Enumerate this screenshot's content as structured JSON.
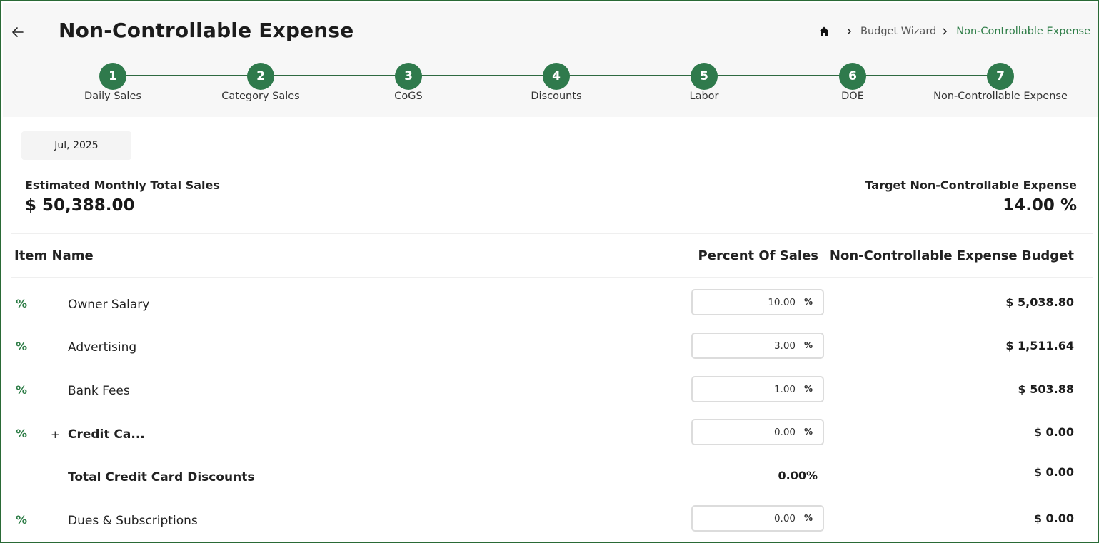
{
  "header": {
    "title": "Non-Controllable Expense",
    "breadcrumb": [
      "Budget Wizard",
      "Non-Controllable Expense"
    ]
  },
  "steps": [
    {
      "number": "1",
      "label": "Daily Sales"
    },
    {
      "number": "2",
      "label": "Category Sales"
    },
    {
      "number": "3",
      "label": "CoGS"
    },
    {
      "number": "4",
      "label": "Discounts"
    },
    {
      "number": "5",
      "label": "Labor"
    },
    {
      "number": "6",
      "label": "DOE"
    },
    {
      "number": "7",
      "label": "Non-Controllable Expense"
    }
  ],
  "period": "Jul, 2025",
  "summary": {
    "sales_label": "Estimated Monthly Total Sales",
    "sales_value": "$ 50,388.00",
    "target_label": "Target Non-Controllable Expense",
    "target_value": "14.00 %"
  },
  "table": {
    "headers": [
      "Item Name",
      "Percent Of Sales",
      "Non-Controllable Expense Budget"
    ],
    "rows": [
      {
        "icon": "%",
        "name": "Owner Salary",
        "percent": "10.00",
        "unit": "%",
        "budget": "$ 5,038.80"
      },
      {
        "icon": "%",
        "name": "Advertising",
        "percent": "3.00",
        "unit": "%",
        "budget": "$ 1,511.64"
      },
      {
        "icon": "%",
        "name": "Bank Fees",
        "percent": "1.00",
        "unit": "%",
        "budget": "$ 503.88"
      },
      {
        "icon": "%",
        "expand": "+",
        "name": "Credit Ca...",
        "percent": "0.00",
        "unit": "%",
        "budget": "$ 0.00"
      },
      {
        "name": "Total Credit Card Discounts",
        "percent": "0.00%",
        "budget": "$ 0.00"
      },
      {
        "icon": "%",
        "name": "Dues & Subscriptions",
        "percent": "0.00",
        "unit": "%",
        "budget": "$ 0.00"
      }
    ]
  },
  "colors": {
    "accent": "#2f7a4c",
    "frame": "#2a6a36",
    "breadcrumb_current": "#2e7d47"
  },
  "icons": [
    "back-arrow-icon",
    "home-icon",
    "chevron-right-icon",
    "percent-icon",
    "plus-icon"
  ]
}
